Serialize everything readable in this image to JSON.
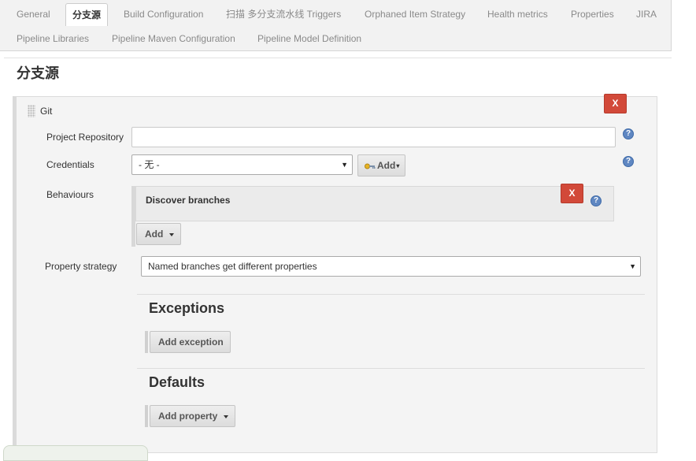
{
  "tabs": [
    {
      "label": "General",
      "active": false
    },
    {
      "label": "分支源",
      "active": true
    },
    {
      "label": "Build Configuration",
      "active": false
    },
    {
      "label": "扫描 多分支流水线 Triggers",
      "active": false
    },
    {
      "label": "Orphaned Item Strategy",
      "active": false
    },
    {
      "label": "Health metrics",
      "active": false
    },
    {
      "label": "Properties",
      "active": false
    },
    {
      "label": "JIRA",
      "active": false
    },
    {
      "label": "Pipeline Libraries",
      "active": false
    },
    {
      "label": "Pipeline Maven Configuration",
      "active": false
    },
    {
      "label": "Pipeline Model Definition",
      "active": false
    }
  ],
  "section": {
    "title": "分支源",
    "source": {
      "title": "Git",
      "delete_label": "X",
      "project_repository": {
        "label": "Project Repository",
        "value": ""
      },
      "credentials": {
        "label": "Credentials",
        "selected": "- 无 -",
        "add_label": "Add"
      },
      "behaviours": {
        "label": "Behaviours",
        "items": [
          {
            "label": "Discover branches",
            "delete_label": "X"
          }
        ],
        "add_label": "Add"
      },
      "property_strategy": {
        "label": "Property strategy",
        "selected": "Named branches get different properties"
      },
      "exceptions": {
        "title": "Exceptions",
        "add_label": "Add exception"
      },
      "defaults": {
        "title": "Defaults",
        "add_label": "Add property"
      }
    }
  },
  "help_glyph": "?",
  "colors": {
    "delete": "#d24939",
    "help": "#5f87c2"
  }
}
